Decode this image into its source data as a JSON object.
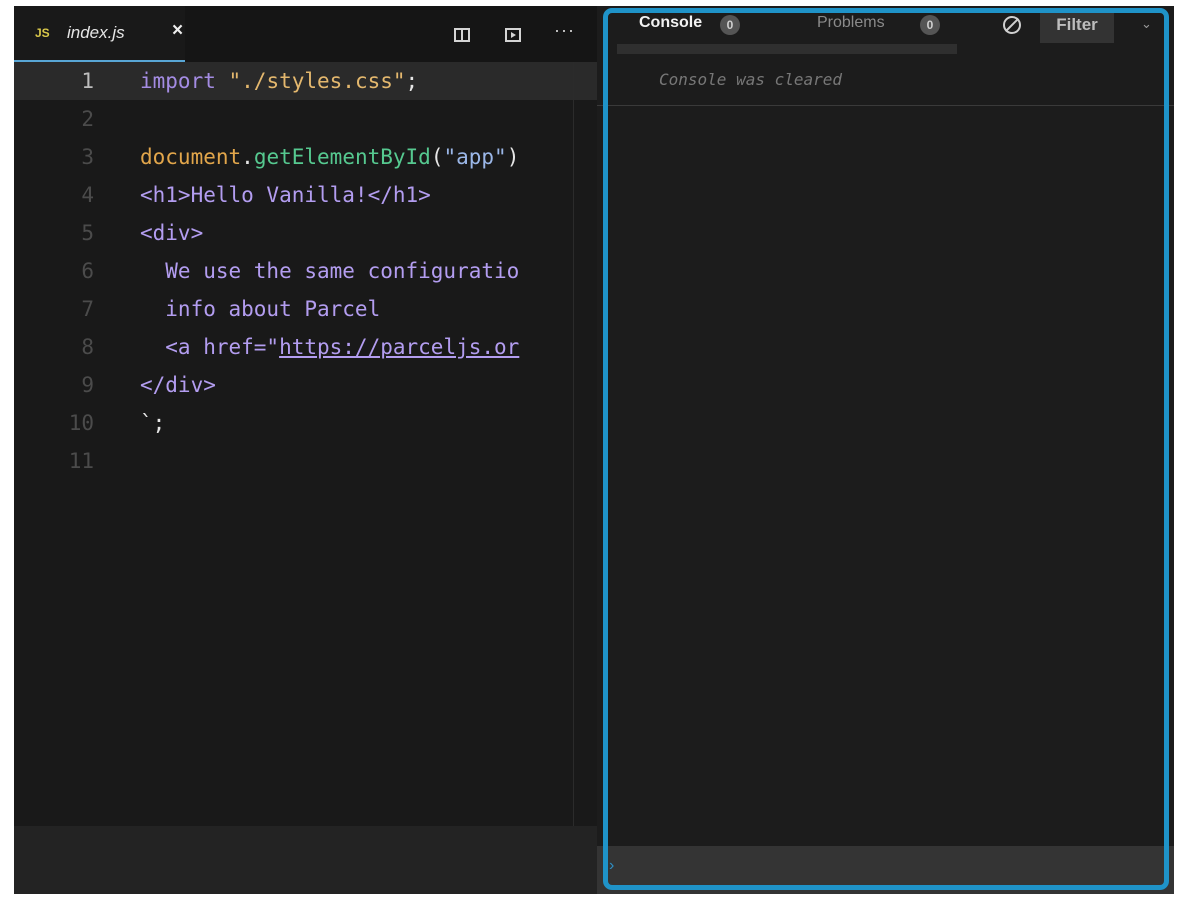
{
  "editor": {
    "tab": {
      "lang_badge": "JS",
      "filename": "index.js",
      "close": "×"
    },
    "toolbar": {
      "more": "···"
    },
    "lines": [
      {
        "n": "1",
        "tokens": [
          [
            "import ",
            "k-import"
          ],
          [
            "\"./styles.css\"",
            "k-str"
          ],
          [
            ";",
            "k-punc"
          ]
        ]
      },
      {
        "n": "2",
        "tokens": []
      },
      {
        "n": "3",
        "tokens": [
          [
            "document",
            "k-obj"
          ],
          [
            ".",
            "k-punc"
          ],
          [
            "getElementById",
            "k-fn"
          ],
          [
            "(",
            "k-punc"
          ],
          [
            "\"app\"",
            "k-strin"
          ],
          [
            ")",
            "k-punc"
          ]
        ]
      },
      {
        "n": "4",
        "tokens": [
          [
            "<h1>Hello Vanilla!</h1>",
            "k-tag"
          ]
        ]
      },
      {
        "n": "5",
        "tokens": [
          [
            "<div>",
            "k-tag"
          ]
        ]
      },
      {
        "n": "6",
        "tokens": [
          [
            "  We use the same configuratio",
            "k-tag"
          ]
        ]
      },
      {
        "n": "7",
        "tokens": [
          [
            "  info about Parcel",
            "k-tag"
          ]
        ]
      },
      {
        "n": "8",
        "tokens": [
          [
            "  <a href=\"",
            "k-tag"
          ],
          [
            "https://parceljs.or",
            "k-link"
          ]
        ]
      },
      {
        "n": "9",
        "tokens": [
          [
            "</div>",
            "k-tag"
          ]
        ]
      },
      {
        "n": "10",
        "tokens": [
          [
            "`;",
            "k-punc"
          ]
        ]
      },
      {
        "n": "11",
        "tokens": []
      }
    ]
  },
  "console": {
    "tabs": [
      {
        "label": "Console",
        "count": "0"
      },
      {
        "label": "Problems",
        "count": "0"
      }
    ],
    "filter_label": "Filter",
    "chevron": "⌄",
    "message": "Console was cleared",
    "prompt": "›"
  }
}
